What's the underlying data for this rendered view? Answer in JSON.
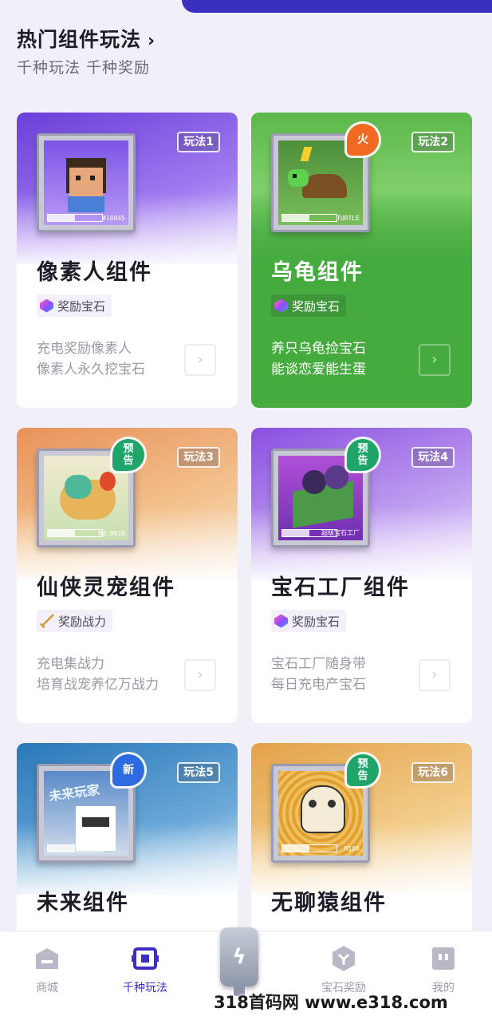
{
  "section": {
    "title": "热门组件玩法",
    "subtitle": "千种玩法 千种奖励"
  },
  "cards": [
    {
      "tag": "玩法1",
      "title": "像素人组件",
      "reward": "奖励宝石",
      "reward_icon": "gem-icon",
      "desc1": "充电奖励像素人",
      "desc2": "像素人永久挖宝石",
      "art_text": "CHARGING",
      "art_label": "#10845",
      "badge": ""
    },
    {
      "tag": "玩法2",
      "title": "乌龟组件",
      "reward": "奖励宝石",
      "reward_icon": "gem-icon",
      "desc1": "养只乌龟捡宝石",
      "desc2": "能谈恋爱能生蛋",
      "art_text": "CHARGING",
      "art_label": "TURTLE",
      "badge": "火"
    },
    {
      "tag": "玩法3",
      "title": "仙侠灵宠组件",
      "reward": "奖励战力",
      "reward_icon": "sword-icon",
      "desc1": "充电集战力",
      "desc2": "培育战宠养亿万战力",
      "art_text": "CHARGING",
      "art_label": "NO.0016",
      "badge": "预告"
    },
    {
      "tag": "玩法4",
      "title": "宝石工厂组件",
      "reward": "奖励宝石",
      "reward_icon": "gem-icon",
      "desc1": "宝石工厂随身带",
      "desc2": "每日充电产宝石",
      "art_text": "CHARGING",
      "art_label": "超级宝石工厂",
      "badge": "预告"
    },
    {
      "tag": "玩法5",
      "title": "未来组件",
      "art_text": "未来玩家",
      "badge": "新"
    },
    {
      "tag": "玩法6",
      "title": "无聊猿组件",
      "art_text": "CHARGING",
      "art_label": "M100",
      "badge": "预告"
    }
  ],
  "tabbar": {
    "items": [
      {
        "label": "商城",
        "icon": "shop-icon"
      },
      {
        "label": "千种玩法",
        "icon": "play-icon"
      },
      {
        "label": "宝石奖励",
        "icon": "gem-reward-icon"
      },
      {
        "label": "我的",
        "icon": "profile-icon"
      }
    ],
    "active": "千种玩法",
    "center_icon": "charger-icon"
  },
  "watermark": "318首码网 www.e318.com",
  "colors": {
    "accent": "#3b2fbf",
    "green_card": "#46ab3f",
    "hot": "#f26a21",
    "preview": "#1fa56a",
    "new": "#2f6be0"
  }
}
